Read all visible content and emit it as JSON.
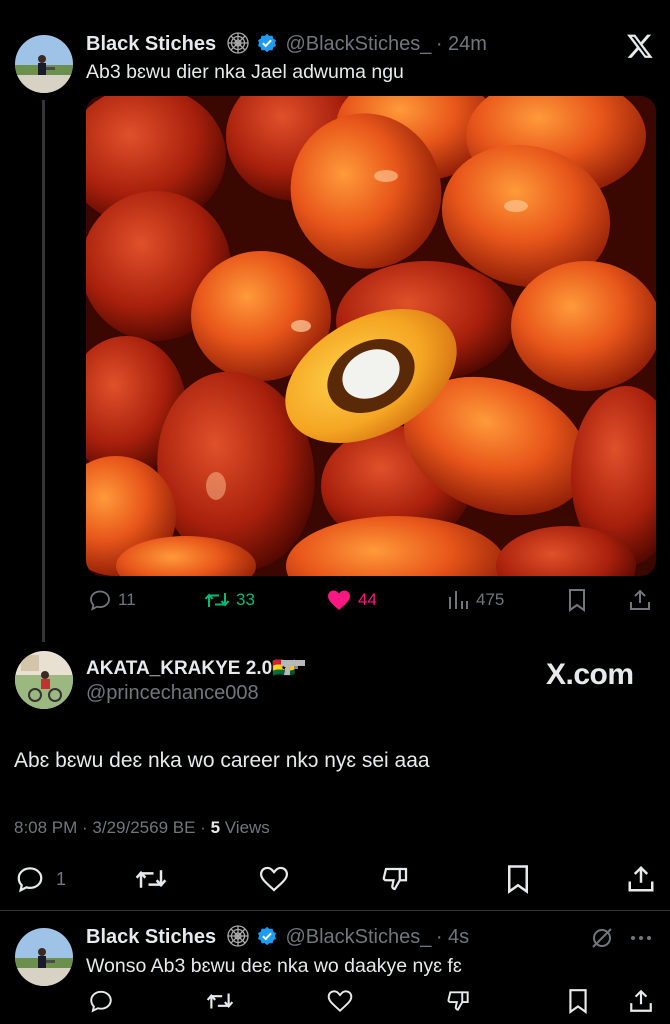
{
  "quoted_tweet": {
    "name": "Black Stiches",
    "handle": "@BlackStiches_",
    "time": "· 24m",
    "text": "Ab3 bɛwu dier nka Jael adwuma ngu",
    "stats": {
      "replies": "11",
      "retweets": "33",
      "likes": "44",
      "views": "475"
    }
  },
  "main_tweet": {
    "name": "AKATA_KRAKYE 2.0🇬🇭",
    "handle": "@princechance008",
    "brand": "X.com",
    "text": "Abɛ bɛwu deɛ nka wo career nkɔ nyɛ sei aaa",
    "meta_time": "8:08 PM · 3/29/2569 BE · ",
    "views_count": "5",
    "views_label": " Views",
    "replies": "1"
  },
  "reply_tweet": {
    "name": "Black Stiches",
    "handle": "@BlackStiches_",
    "time": "· 4s",
    "text": "Wonso Ab3 bɛwu deɛ nka wo daakye nyɛ fɛ"
  },
  "colors": {
    "retweet_green": "#00ba7c",
    "like_pink": "#f91880",
    "verified_blue": "#1d9bf0",
    "muted": "#71767b"
  }
}
